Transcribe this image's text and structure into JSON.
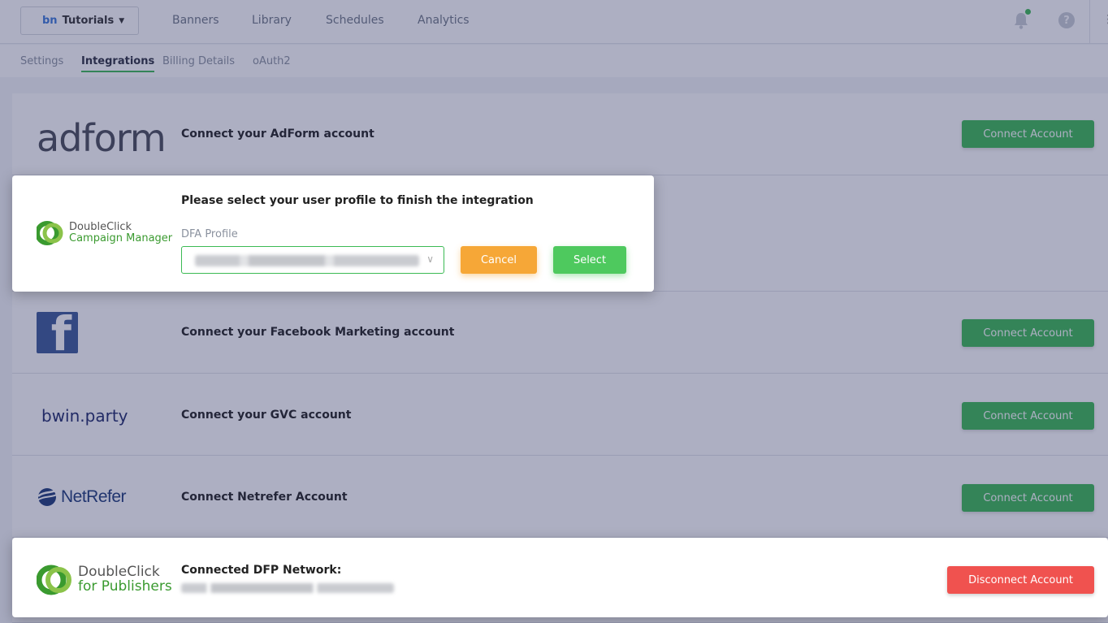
{
  "topbar": {
    "workspace_logo": "bn",
    "workspace_name": "Tutorials",
    "nav": [
      "Banners",
      "Library",
      "Schedules",
      "Analytics"
    ],
    "help_label": "?"
  },
  "subtabs": [
    "Settings",
    "Integrations",
    "Billing Details",
    "oAuth2"
  ],
  "active_subtab": "Integrations",
  "integrations": {
    "adform": {
      "logo": "adform",
      "text": "Connect your AdForm account",
      "button": "Connect Account"
    },
    "dcm": {
      "logo_line1": "DoubleClick",
      "logo_line2": "Campaign Manager",
      "prompt": "Please select your user profile to finish the integration",
      "field_label": "DFA Profile",
      "cancel": "Cancel",
      "select": "Select"
    },
    "facebook": {
      "logo": "f",
      "text": "Connect your Facebook Marketing account",
      "button": "Connect Account"
    },
    "gvc": {
      "logo": "bwin.party",
      "text": "Connect your GVC account",
      "button": "Connect Account"
    },
    "netrefer": {
      "logo": "NetRefer",
      "text": "Connect Netrefer Account",
      "button": "Connect Account"
    },
    "dfp": {
      "logo_line1": "DoubleClick",
      "logo_line2": "for Publishers",
      "label": "Connected DFP Network:",
      "button": "Disconnect Account"
    }
  },
  "colors": {
    "green": "#3cba54",
    "orange": "#f6a737",
    "red": "#f0524f",
    "overlay": "#282c5f"
  }
}
